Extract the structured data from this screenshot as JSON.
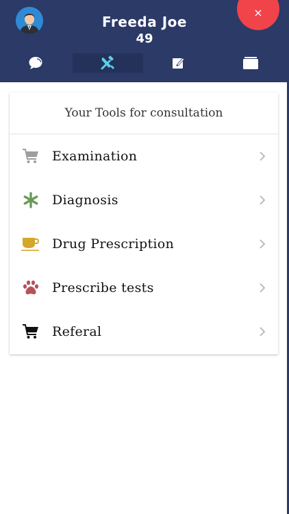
{
  "header": {
    "patient_name": "Freeda Joe",
    "patient_age": "49",
    "close_glyph": "×",
    "background_color": "#2b3a67",
    "fab_color": "#f0434a"
  },
  "tabs": [
    {
      "icon": "chat-bubble-icon",
      "active": false
    },
    {
      "icon": "tools-icon",
      "active": true
    },
    {
      "icon": "edit-note-icon",
      "active": false
    },
    {
      "icon": "cards-icon",
      "active": false
    }
  ],
  "tools_card": {
    "title": "Your Tools for consultation",
    "items": [
      {
        "label": "Examination",
        "icon": "shopping-cart-icon",
        "icon_color": "#9e9e9e"
      },
      {
        "label": "Diagnosis",
        "icon": "asterisk-icon",
        "icon_color": "#6a9a5a"
      },
      {
        "label": "Drug Prescription",
        "icon": "cup-icon",
        "icon_color": "#d4a62a"
      },
      {
        "label": "Prescribe tests",
        "icon": "paw-icon",
        "icon_color": "#b5525a"
      },
      {
        "label": "Referal",
        "icon": "shopping-cart-icon",
        "icon_color": "#111111"
      }
    ]
  }
}
